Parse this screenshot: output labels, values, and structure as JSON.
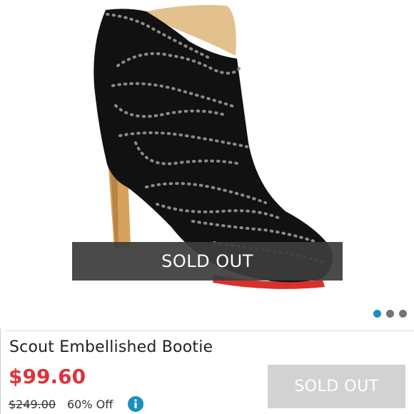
{
  "product": {
    "name": "Scout Embellished Bootie",
    "price": "$99.60",
    "original_price": "$249.00",
    "discount": "60% Off"
  },
  "image_overlay": {
    "label": "SOLD OUT"
  },
  "carousel": {
    "total_slides": 3,
    "active_slide": 1
  },
  "purchase": {
    "button_label": "SOLD OUT"
  },
  "icons": {
    "info": "info-icon"
  },
  "colors": {
    "price": "#e0323b",
    "active_dot": "#1a8fc0",
    "inactive_dot": "#737373",
    "info": "#1a8fc0",
    "disabled_button": "#d2d2d2"
  }
}
